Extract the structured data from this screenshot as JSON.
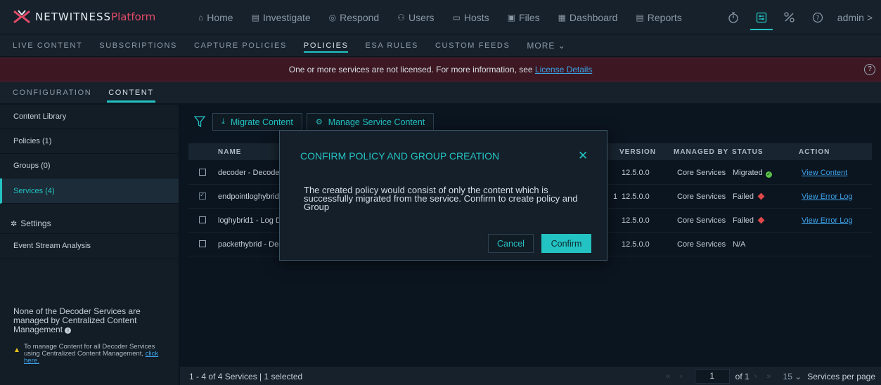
{
  "app": {
    "logo_text": "NETWITNESS",
    "logo_suffix": "Platform"
  },
  "nav": {
    "items": [
      {
        "icon": "⌂",
        "label": "Home"
      },
      {
        "icon": "▤",
        "label": "Investigate"
      },
      {
        "icon": "◎",
        "label": "Respond"
      },
      {
        "icon": "⚇",
        "label": "Users"
      },
      {
        "icon": "▭",
        "label": "Hosts"
      },
      {
        "icon": "▣",
        "label": "Files"
      },
      {
        "icon": "▦",
        "label": "Dashboard"
      },
      {
        "icon": "▤",
        "label": "Reports"
      }
    ],
    "right_icons": [
      "stopwatch-icon",
      "admin-panel-icon",
      "tools-icon",
      "help-icon"
    ],
    "user_label": "admin >"
  },
  "subnav": {
    "items": [
      "LIVE CONTENT",
      "SUBSCRIPTIONS",
      "CAPTURE POLICIES",
      "POLICIES",
      "ESA RULES",
      "CUSTOM FEEDS",
      "MORE ⌄"
    ],
    "active": "POLICIES"
  },
  "banner": {
    "text": "One or more services are not licensed. For more information, see ",
    "link": "License Details",
    "help_icon": "?"
  },
  "config_tabs": {
    "items": [
      "CONFIGURATION",
      "CONTENT"
    ],
    "active": "CONTENT"
  },
  "sidebar": {
    "items": [
      "Content Library",
      "Policies (1)",
      "Groups (0)",
      "Services (4)"
    ],
    "active": "Services (4)",
    "settings_label": "Settings",
    "esa_label": "Event Stream Analysis",
    "note": "None of the Decoder Services are managed by Centralized Content Management",
    "warning": "To manage Content for all Decoder Services using Centralized Content Management, ",
    "warning_link": "click here."
  },
  "toolbar": {
    "migrate_label": "Migrate Content",
    "manage_label": "Manage Service Content"
  },
  "table": {
    "headers": {
      "name": "NAME",
      "version": "VERSION",
      "managed_by": "MANAGED BY",
      "status": "STATUS",
      "action": "ACTION"
    },
    "rows": [
      {
        "name": "decoder - Decoder",
        "name_tail": "",
        "version": "12.5.0.0",
        "managed_by": "Core Services",
        "status": "Migrated",
        "status_kind": "ok",
        "action": "View Content",
        "checked": false
      },
      {
        "name": "endpointloghybrid",
        "name_tail": "1",
        "version": "12.5.0.0",
        "managed_by": "Core Services",
        "status": "Failed",
        "status_kind": "fail",
        "action": "View Error Log",
        "checked": true
      },
      {
        "name": "loghybrid1 - Log D",
        "name_tail": "",
        "version": "12.5.0.0",
        "managed_by": "Core Services",
        "status": "Failed",
        "status_kind": "fail",
        "action": "View Error Log",
        "checked": false
      },
      {
        "name": "packethybrid - Dec",
        "name_tail": "",
        "version": "12.5.0.0",
        "managed_by": "Core Services",
        "status": "N/A",
        "status_kind": "none",
        "action": "",
        "checked": false
      }
    ]
  },
  "footer": {
    "count_text": "1 - 4 of 4 Services | 1 selected",
    "page": "1",
    "of_label": "of",
    "total_pages": "1",
    "per_page": "15",
    "per_page_label": "Services per page"
  },
  "modal": {
    "title": "CONFIRM POLICY AND GROUP CREATION",
    "body": "The created policy would consist of only the content which is successfully migrated from the service. Confirm to create policy and Group",
    "cancel_label": "Cancel",
    "confirm_label": "Confirm"
  },
  "colors": {
    "accent": "#24c3c3",
    "brand_red": "#e24b68",
    "ok": "#5bc24a",
    "fail": "#e04848",
    "link": "#3da2e8"
  }
}
